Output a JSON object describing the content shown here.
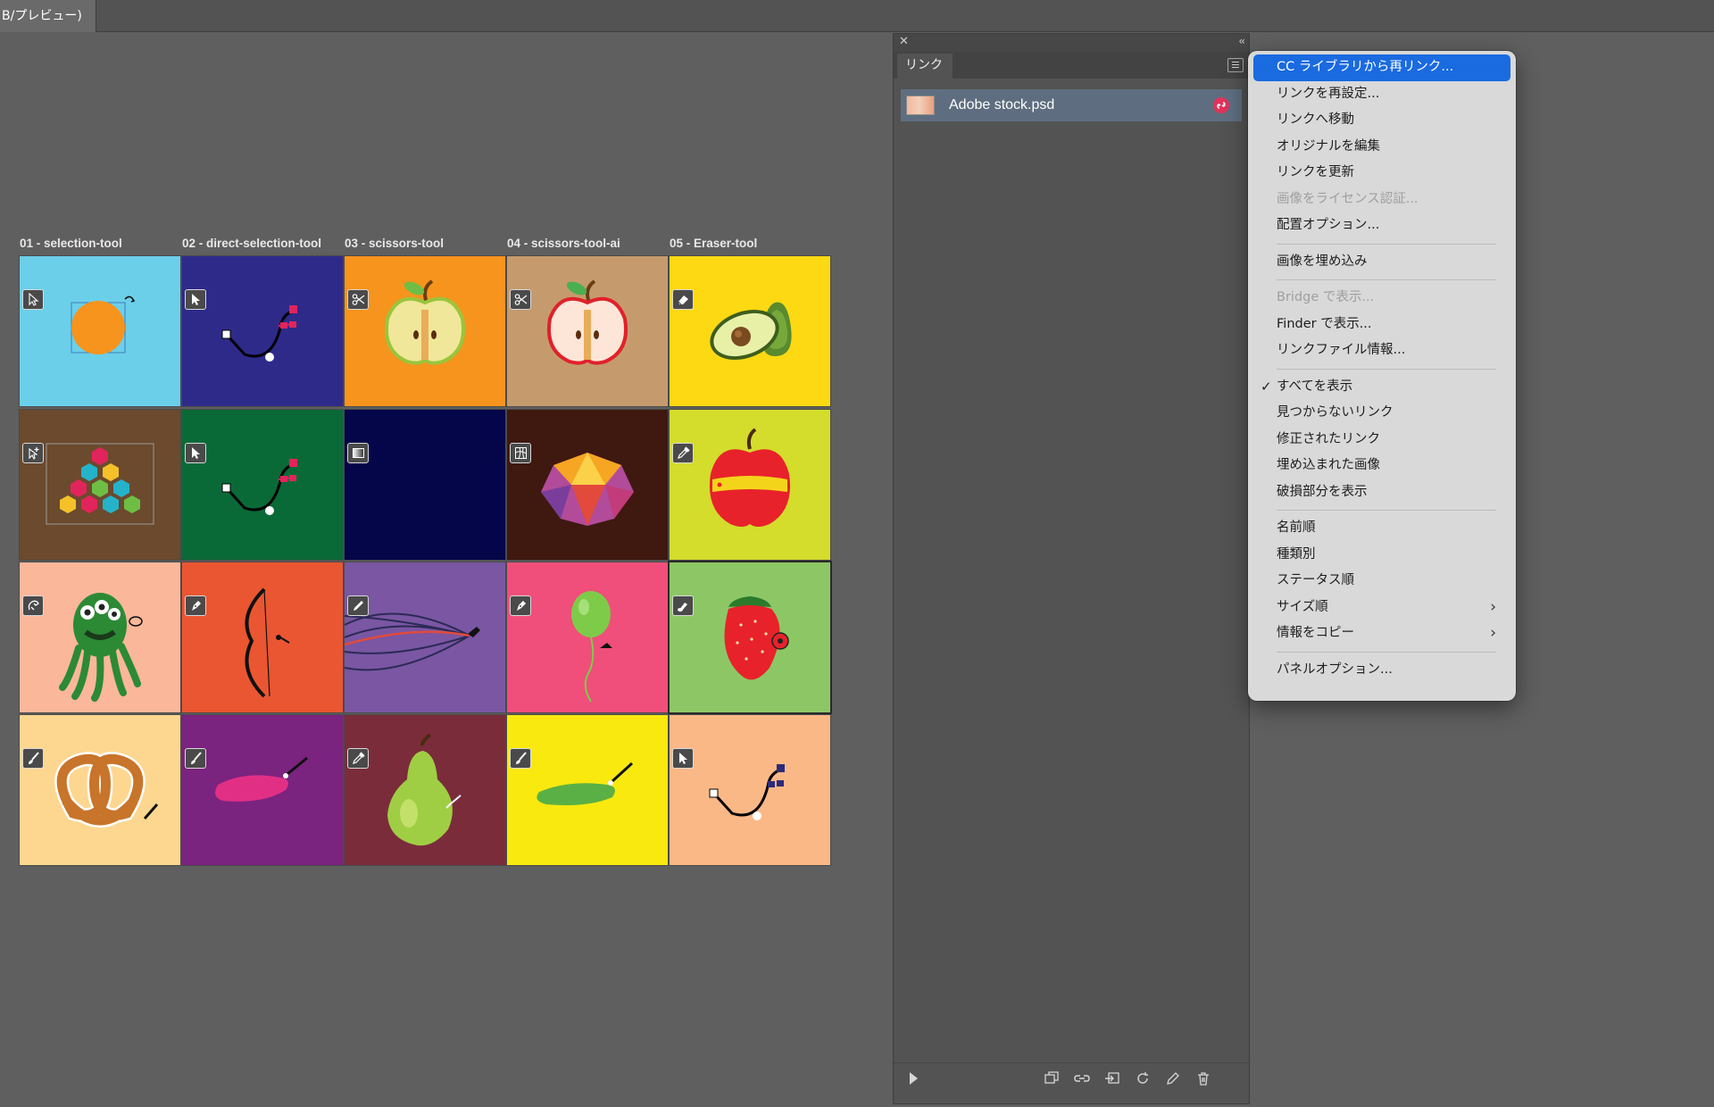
{
  "document_tab": {
    "title": "B/プレビュー)"
  },
  "artboards": {
    "labels": [
      "01 - selection-tool",
      "02 - direct-selection-tool",
      "03 - scissors-tool",
      "04 - scissors-tool-ai",
      "05 - Eraser-tool"
    ],
    "cells": [
      {
        "bg": "#6ccfea",
        "tool": "selection-arrow-icon",
        "art": "orange-circle"
      },
      {
        "bg": "#2e2a8a",
        "tool": "direct-selection-arrow-icon",
        "art": "bezier-path"
      },
      {
        "bg": "#f7941d",
        "tool": "scissors-icon",
        "art": "apple-half-yellow"
      },
      {
        "bg": "#c59b6d",
        "tool": "scissors-icon",
        "art": "apple-half-red"
      },
      {
        "bg": "#fcd912",
        "tool": "eraser-icon",
        "art": "avocado"
      },
      {
        "bg": "#6b4a2e",
        "tool": "add-anchor-icon",
        "art": "hexagon-pyramid"
      },
      {
        "bg": "#0a6a37",
        "tool": "direct-selection-arrow-icon",
        "art": "bezier-path"
      },
      {
        "bg": "#05054a",
        "tool": "gradient-icon",
        "art": "empty"
      },
      {
        "bg": "#3f1810",
        "tool": "mesh-icon",
        "art": "polygon-gem"
      },
      {
        "bg": "#d4dc2c",
        "tool": "eyedropper-icon",
        "art": "red-apple"
      },
      {
        "bg": "#fab79a",
        "tool": "puppet-warp-icon",
        "art": "octopus"
      },
      {
        "bg": "#ea5632",
        "tool": "pen-icon",
        "art": "bow"
      },
      {
        "bg": "#7a56a3",
        "tool": "pencil-icon",
        "art": "curves"
      },
      {
        "bg": "#ef4f7a",
        "tool": "pen-icon",
        "art": "balloon"
      },
      {
        "bg": "#8dc765",
        "tool": "blob-brush-icon",
        "art": "strawberry"
      },
      {
        "bg": "#fdd790",
        "tool": "paint-brush-icon",
        "art": "pretzel"
      },
      {
        "bg": "#7a237f",
        "tool": "paint-brush-icon",
        "art": "pink-stroke"
      },
      {
        "bg": "#7b2c3b",
        "tool": "eyedropper-icon",
        "art": "pear"
      },
      {
        "bg": "#f9e90f",
        "tool": "paint-brush-icon",
        "art": "green-stroke"
      },
      {
        "bg": "#fbb887",
        "tool": "direct-selection-arrow-icon",
        "art": "bezier-path-navy"
      }
    ]
  },
  "links_panel": {
    "tab_label": "リンク",
    "items": [
      {
        "name": "Adobe stock.psd"
      }
    ]
  },
  "context_menu": {
    "items": [
      {
        "label": "CC ライブラリから再リンク...",
        "state": "highlight"
      },
      {
        "label": "リンクを再設定..."
      },
      {
        "label": "リンクへ移動"
      },
      {
        "label": "オリジナルを編集"
      },
      {
        "label": "リンクを更新"
      },
      {
        "label": "画像をライセンス認証...",
        "state": "disabled"
      },
      {
        "label": "配置オプション..."
      },
      {
        "separator": true
      },
      {
        "label": "画像を埋め込み"
      },
      {
        "separator": true
      },
      {
        "label": "Bridge で表示...",
        "state": "disabled"
      },
      {
        "label": "Finder で表示..."
      },
      {
        "label": "リンクファイル情報..."
      },
      {
        "separator": true
      },
      {
        "label": "すべてを表示",
        "checked": true
      },
      {
        "label": "見つからないリンク"
      },
      {
        "label": "修正されたリンク"
      },
      {
        "label": "埋め込まれた画像"
      },
      {
        "label": "破損部分を表示"
      },
      {
        "separator": true
      },
      {
        "label": "名前順"
      },
      {
        "label": "種類別"
      },
      {
        "label": "ステータス順"
      },
      {
        "label": "サイズ順",
        "submenu": true
      },
      {
        "label": "情報をコピー",
        "submenu": true
      },
      {
        "separator": true
      },
      {
        "label": "パネルオプション..."
      }
    ]
  },
  "colors": {
    "canvas": "#5f5f5f",
    "panel": "#535353",
    "menu_highlight": "#1a6ae0",
    "link_row": "#5e6e80"
  }
}
